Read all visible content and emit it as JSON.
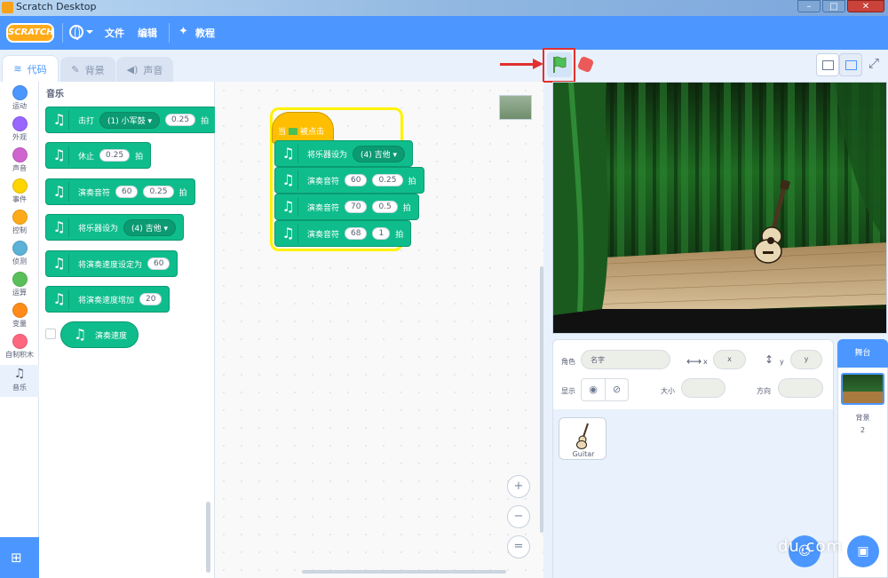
{
  "window": {
    "title": "Scratch Desktop",
    "minimize": "–",
    "maximize": "□",
    "close": "✕"
  },
  "menubar": {
    "logo": "SCRATCH",
    "file": "文件",
    "edit": "编辑",
    "tutorials": "教程"
  },
  "tabs": [
    {
      "label": "代码",
      "icon": "code-icon"
    },
    {
      "label": "背景",
      "icon": "brush-icon"
    },
    {
      "label": "声音",
      "icon": "speaker-icon"
    }
  ],
  "categories": [
    {
      "label": "运动",
      "color": "#4c97ff"
    },
    {
      "label": "外观",
      "color": "#9966ff"
    },
    {
      "label": "声音",
      "color": "#cf63cf"
    },
    {
      "label": "事件",
      "color": "#ffd500"
    },
    {
      "label": "控制",
      "color": "#ffab19"
    },
    {
      "label": "侦测",
      "color": "#5cb1d6"
    },
    {
      "label": "运算",
      "color": "#59c059"
    },
    {
      "label": "变量",
      "color": "#ff8c1a"
    },
    {
      "label": "自制积木",
      "color": "#ff6680"
    },
    {
      "label": "音乐",
      "color": "#0fbd8c"
    }
  ],
  "palette": {
    "title": "音乐",
    "blocks": [
      {
        "text1": "击打",
        "dropdown": "(1) 小军鼓",
        "value": "0.25",
        "text2": "拍"
      },
      {
        "text1": "休止",
        "value": "0.25",
        "text2": "拍"
      },
      {
        "text1": "演奏音符",
        "value": "60",
        "value2": "0.25",
        "text2": "拍"
      },
      {
        "text1": "将乐器设为",
        "dropdown": "(4) 吉他"
      },
      {
        "text1": "将演奏速度设定为",
        "value": "60"
      },
      {
        "text1": "将演奏速度增加",
        "value": "20"
      },
      {
        "text1": "演奏速度"
      }
    ]
  },
  "script": {
    "hat": {
      "before": "当",
      "after": "被点击"
    },
    "blocks": [
      {
        "text1": "将乐器设为",
        "dropdown": "(4) 吉他"
      },
      {
        "text1": "演奏音符",
        "note": "60",
        "beats": "0.25",
        "text2": "拍"
      },
      {
        "text1": "演奏音符",
        "note": "70",
        "beats": "0.5",
        "text2": "拍"
      },
      {
        "text1": "演奏音符",
        "note": "68",
        "beats": "1",
        "text2": "拍"
      }
    ]
  },
  "zoom": {
    "in": "+",
    "out": "−",
    "reset": "="
  },
  "sprite_info": {
    "sprite_label": "角色",
    "name_placeholder": "名字",
    "x_label": "x",
    "x_placeholder": "x",
    "y_label": "y",
    "y_placeholder": "y",
    "show_label": "显示",
    "size_label": "大小",
    "direction_label": "方向"
  },
  "sprites": [
    {
      "name": "Guitar"
    }
  ],
  "stage_pane": {
    "title": "舞台",
    "backdrops_label": "背景",
    "backdrops_count": "2"
  },
  "watermark": "du.com",
  "colors": {
    "scratch_blue": "#4c97ff",
    "music_green": "#0fbd8c",
    "event_yellow": "#ffbf00",
    "highlight_red": "#e03030"
  }
}
